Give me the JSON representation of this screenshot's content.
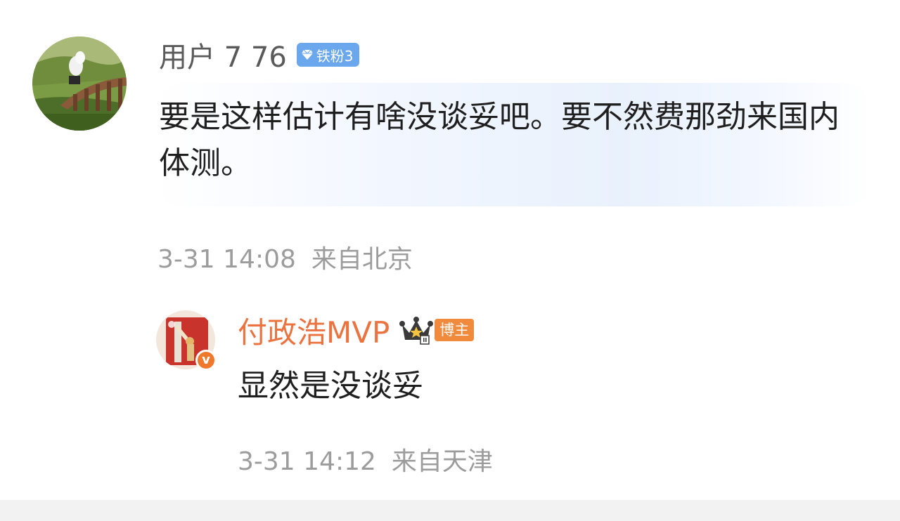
{
  "comment": {
    "username": "用户  7      76",
    "fan_badge": {
      "icon": "diamond-icon",
      "label": "铁粉3",
      "color": "#6aa7ec"
    },
    "text": "要是这样估计有啥没谈妥吧。要不然费那劲来国内体测。",
    "date": "3-31 14:08",
    "location": "来自北京"
  },
  "reply": {
    "username": "付政浩MVP",
    "crown_icon": "crown-level-icon",
    "role_badge": "博主",
    "verified_icon": "v-verified-icon",
    "text": "显然是没谈妥",
    "date": "3-31 14:12",
    "location": "来自天津",
    "name_color": "#eb7340"
  }
}
